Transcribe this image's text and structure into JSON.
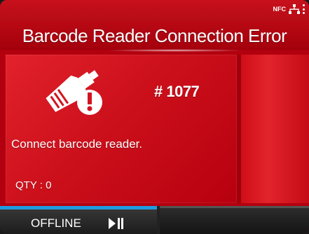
{
  "header": {
    "title": "Barcode Reader Connection Error"
  },
  "status_icons": {
    "nfc": "NFC",
    "network": "network-icon"
  },
  "main": {
    "error_code": "# 1077",
    "message": "Connect barcode reader.",
    "qty": "QTY : 0",
    "icon": "barcode-scanner-error-icon"
  },
  "footer": {
    "mode_label": "OFFLINE",
    "mode_icon": "play-pause-icon"
  },
  "colors": {
    "error_red": "#c8101c",
    "accent_blue": "#1e9be0",
    "footer_dark": "#222222"
  }
}
